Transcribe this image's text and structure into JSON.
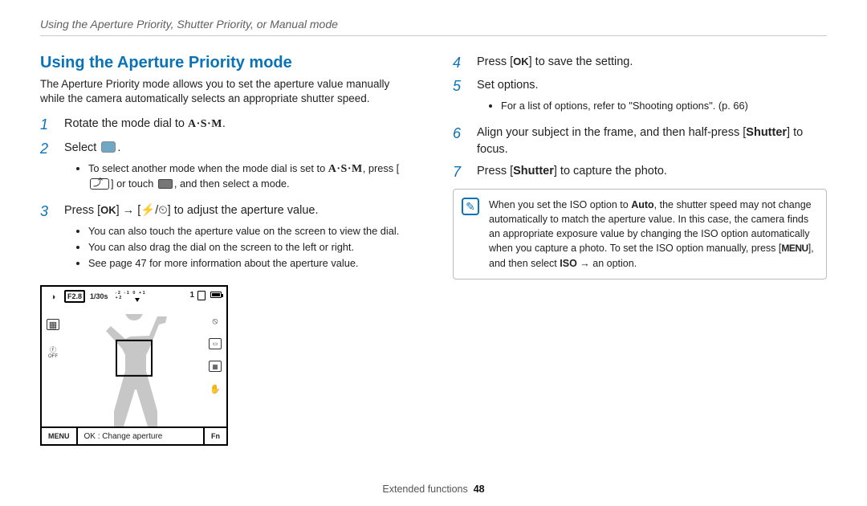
{
  "breadcrumb": "Using the Aperture Priority, Shutter Priority, or Manual mode",
  "section_title": "Using the Aperture Priority mode",
  "intro": "The Aperture Priority mode allows you to set the aperture value manually while the camera automatically selects an appropriate shutter speed.",
  "left_steps": {
    "s1": {
      "num": "1",
      "pre": "Rotate the mode dial to ",
      "asm": "A·S·M",
      "post": "."
    },
    "s2": {
      "num": "2",
      "pre": "Select ",
      "post": "."
    },
    "s2_sub": {
      "a_pre": "To select another mode when the mode dial is set to ",
      "a_asm": "A·S·M",
      "a_mid": ", press [",
      "a_post": "] or touch ",
      "a_end": ", and then select a mode."
    },
    "s3": {
      "num": "3",
      "pre": "Press [",
      "ok": "OK",
      "mid": "] → [",
      "glyphs": "⚡/⏲",
      "post": "] to adjust the aperture value."
    },
    "s3_sub": {
      "a": "You can also touch the aperture value on the screen to view the dial.",
      "b": "You can also drag the dial on the screen to the left or right.",
      "c": "See page 47 for more information about the aperture value."
    }
  },
  "lcd": {
    "f": "F2.8",
    "shutter": "1/30s",
    "meter_ticks": "-2 -1 0 +1 +2",
    "count": "1",
    "menu_btn": "MENU",
    "bottom_text": "OK : Change aperture",
    "fn_btn": "Fn"
  },
  "right_steps": {
    "s4": {
      "num": "4",
      "pre": "Press [",
      "ok": "OK",
      "post": "] to save the setting."
    },
    "s5": {
      "num": "5",
      "text": "Set options."
    },
    "s5_sub": {
      "a": "For a list of options, refer to \"Shooting options\". (p. 66)"
    },
    "s6": {
      "num": "6",
      "pre": "Align your subject in the frame, and then half-press [",
      "bold": "Shutter",
      "post": "] to focus."
    },
    "s7": {
      "num": "7",
      "pre": "Press [",
      "bold": "Shutter",
      "post": "] to capture the photo."
    }
  },
  "note": {
    "pre": "When you set the ISO option to ",
    "auto": "Auto",
    "mid": ", the shutter speed may not change automatically to match the aperture value. In this case, the camera finds an appropriate exposure value by changing the ISO option automatically when you capture a photo. To set the ISO option manually, press [",
    "menu": "MENU",
    "mid2": "], and then select ",
    "iso": "ISO",
    "post": " → an option."
  },
  "footer": {
    "section": "Extended functions",
    "page": "48"
  }
}
